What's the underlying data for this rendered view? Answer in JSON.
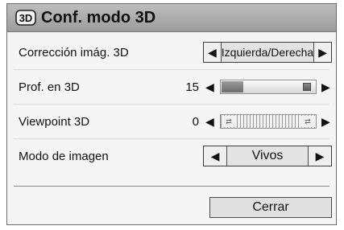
{
  "header": {
    "title": "Conf. modo 3D",
    "icon": "3d-icon",
    "icon_text": "3D"
  },
  "rows": [
    {
      "label": "Corrección imág. 3D",
      "type": "selector",
      "value": "Izquierda/Derecha"
    },
    {
      "label": "Prof. en 3D",
      "type": "slider",
      "value": "15",
      "fill_fraction": 0.23
    },
    {
      "label": "Viewpoint 3D",
      "type": "slider",
      "value": "0",
      "fill_fraction": 0.5
    },
    {
      "label": "Modo de imagen",
      "type": "selector",
      "value": "Vivos"
    }
  ],
  "footer": {
    "close_label": "Cerrar"
  },
  "icons": {
    "left_arrow": "◀",
    "right_arrow": "▶"
  },
  "colors": {
    "title_bar": "#a9a9a9",
    "panel_bg": "#f5f5f5",
    "border": "#3a3a3a"
  }
}
